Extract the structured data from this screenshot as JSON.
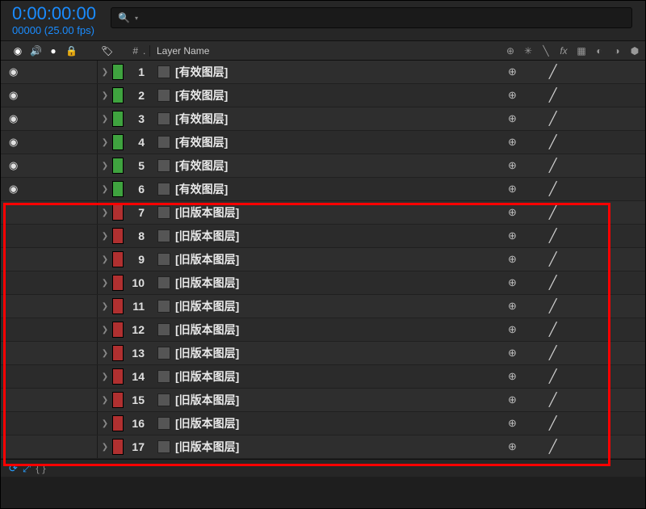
{
  "header": {
    "timecode": "0:00:00:00",
    "framecount": "00000 (25.00 fps)",
    "search_placeholder": ""
  },
  "columns": {
    "hash": "#",
    "dot": ".",
    "layer_name": "Layer Name"
  },
  "switch_icons": [
    "⊕",
    "☀",
    "↘",
    "fx",
    "▦",
    "◐",
    "◑",
    "⬢"
  ],
  "layers": [
    {
      "num": 1,
      "color": "green",
      "name": "[有效图层]",
      "visible": true
    },
    {
      "num": 2,
      "color": "green",
      "name": "[有效图层]",
      "visible": true
    },
    {
      "num": 3,
      "color": "green",
      "name": "[有效图层]",
      "visible": true
    },
    {
      "num": 4,
      "color": "green",
      "name": "[有效图层]",
      "visible": true
    },
    {
      "num": 5,
      "color": "green",
      "name": "[有效图层]",
      "visible": true
    },
    {
      "num": 6,
      "color": "green",
      "name": "[有效图层]",
      "visible": true
    },
    {
      "num": 7,
      "color": "red",
      "name": "[旧版本图层]",
      "visible": false
    },
    {
      "num": 8,
      "color": "red",
      "name": "[旧版本图层]",
      "visible": false
    },
    {
      "num": 9,
      "color": "red",
      "name": "[旧版本图层]",
      "visible": false
    },
    {
      "num": 10,
      "color": "red",
      "name": "[旧版本图层]",
      "visible": false
    },
    {
      "num": 11,
      "color": "red",
      "name": "[旧版本图层]",
      "visible": false
    },
    {
      "num": 12,
      "color": "red",
      "name": "[旧版本图层]",
      "visible": false
    },
    {
      "num": 13,
      "color": "red",
      "name": "[旧版本图层]",
      "visible": false
    },
    {
      "num": 14,
      "color": "red",
      "name": "[旧版本图层]",
      "visible": false
    },
    {
      "num": 15,
      "color": "red",
      "name": "[旧版本图层]",
      "visible": false
    },
    {
      "num": 16,
      "color": "red",
      "name": "[旧版本图层]",
      "visible": false
    },
    {
      "num": 17,
      "color": "red",
      "name": "[旧版本图层]",
      "visible": false
    }
  ]
}
